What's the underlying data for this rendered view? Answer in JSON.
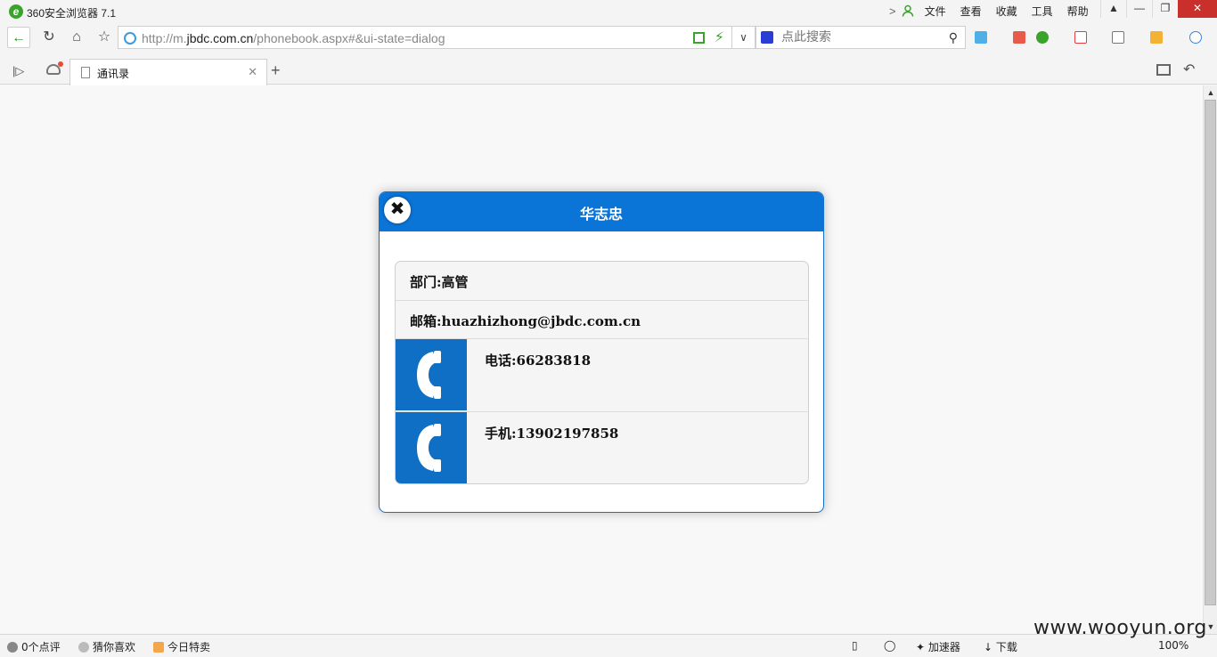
{
  "app": {
    "title": "360安全浏览器 7.1"
  },
  "menu": {
    "items": [
      "文件",
      "查看",
      "收藏",
      "工具",
      "帮助"
    ]
  },
  "address": {
    "url_prefix": "http://m.",
    "url_domain": "jbdc.com.cn",
    "url_path": "/phonebook.aspx#&ui-state=dialog"
  },
  "search": {
    "placeholder": "点此搜索"
  },
  "tab": {
    "title": "通讯录"
  },
  "dialog": {
    "title": "华志忠",
    "department": "部门:高管",
    "email": "邮箱:huazhizhong@jbdc.com.cn",
    "phone": "电话:66283818",
    "mobile": "手机:13902197858"
  },
  "statusbar": {
    "comments": "0个点评",
    "guess": "猜你喜欢",
    "deals": "今日特卖",
    "accelerator": "加速器",
    "download": "下载",
    "zoom": "100%"
  },
  "watermark": "www.wooyun.org",
  "colors": {
    "dialog_header": "#0a74d7",
    "phone_icon_bg": "#0f6fc4",
    "accent_green": "#3aa32c"
  }
}
